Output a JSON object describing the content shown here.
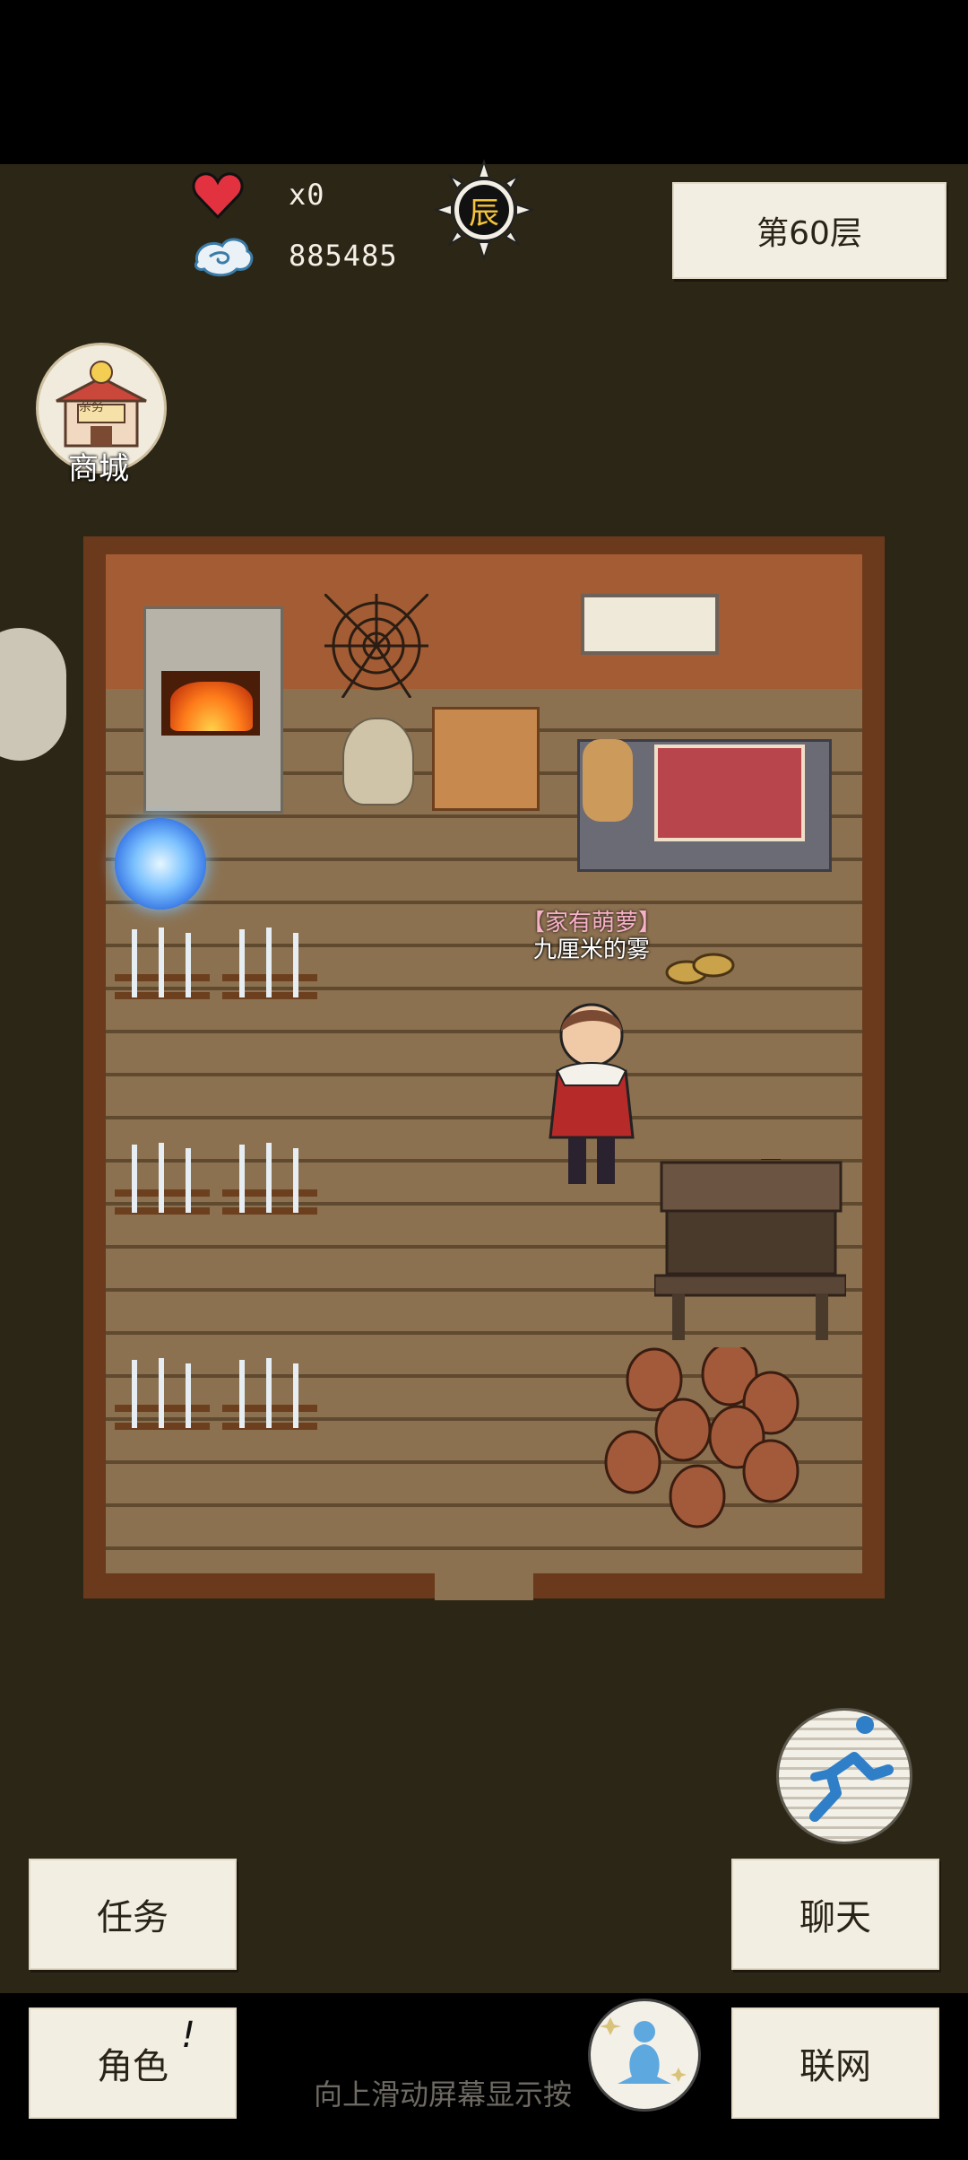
{
  "status": {
    "lives": "x0",
    "currency": "885485",
    "time_label": "辰"
  },
  "floor_button": "第60层",
  "shop": {
    "label": "商城",
    "sign": "杂务"
  },
  "npc": {
    "title": "【家有萌萝】",
    "name": "九厘米的雾"
  },
  "buttons": {
    "task": "任务",
    "chat": "聊天",
    "role": "角色",
    "role_badge": "!",
    "network": "联网"
  },
  "hint": "向上滑动屏幕显示按",
  "colors": {
    "accent_heart": "#e2323f",
    "paper": "#f3eee2",
    "background": "#2c2616"
  },
  "icons": [
    "heart-icon",
    "spirit-cloud-icon",
    "sun-clock-icon",
    "shop-icon",
    "running-icon",
    "meditation-icon"
  ]
}
